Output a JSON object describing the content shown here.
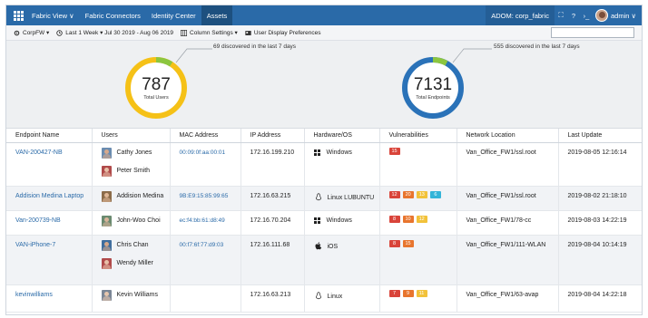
{
  "nav": {
    "items": [
      "Fabric View ∨",
      "Fabric Connectors",
      "Identity Center",
      "Assets"
    ],
    "adom": "ADOM: corp_fabric",
    "user": "admin ∨"
  },
  "toolbar": {
    "device": "CorpFW ▾",
    "time_range": "Last 1 Week ▾ Jul 30 2019 - Aug 06 2019",
    "column_settings": "Column Settings ▾",
    "user_display": "User Display Preferences",
    "search_value": ""
  },
  "summary": {
    "users": {
      "count": "787",
      "label": "Total Users",
      "discovered": "69 discovered in the last 7 days",
      "discovered_fraction": 0.09
    },
    "endpoints": {
      "count": "7131",
      "label": "Total Endpoints",
      "discovered": "555 discovered in the last 7 days",
      "discovered_fraction": 0.08
    }
  },
  "colors": {
    "nav": "#2a6aa8",
    "users_ring": "#f5c117",
    "endpoints_ring": "#2a72b8",
    "discovered_ring": "#8cc63f",
    "link": "#2a6aa8"
  },
  "table": {
    "headers": [
      "Endpoint Name",
      "Users",
      "MAC Address",
      "IP Address",
      "Hardware/OS",
      "Vulnerabilities",
      "Network Location",
      "Last Update"
    ],
    "rows": [
      {
        "endpoint": "VAN-200427-NB",
        "users": [
          "Cathy Jones",
          "Peter Smith"
        ],
        "mac": "00:09:0f:aa:00:01",
        "ip": "172.16.199.210",
        "os_icon": "windows-icon",
        "os": "Windows",
        "vulns": [
          {
            "sev": "critical",
            "count": "15"
          }
        ],
        "location": "Van_Office_FW1/ssl.root",
        "updated": "2019-08-05 12:16:14"
      },
      {
        "endpoint": "Addision Medina Laptop",
        "users": [
          "Addision Medina"
        ],
        "mac": "9B:E9:15:85:99:65",
        "ip": "172.16.63.215",
        "os_icon": "linux-icon",
        "os": "Linux LUBUNTU",
        "vulns": [
          {
            "sev": "critical",
            "count": "12"
          },
          {
            "sev": "high",
            "count": "20"
          },
          {
            "sev": "medium",
            "count": "13"
          },
          {
            "sev": "low",
            "count": "6"
          }
        ],
        "location": "Van_Office_FW1/ssl.root",
        "updated": "2019-08-02 21:18:10"
      },
      {
        "endpoint": "Van-200739-NB",
        "users": [
          "John-Woo Choi"
        ],
        "mac": "ec:f4:bb:61:d8:49",
        "ip": "172.16.70.204",
        "os_icon": "windows-icon",
        "os": "Windows",
        "vulns": [
          {
            "sev": "critical",
            "count": "8"
          },
          {
            "sev": "high",
            "count": "10"
          },
          {
            "sev": "medium",
            "count": "12"
          }
        ],
        "location": "Van_Office_FW1/78-cc",
        "updated": "2019-08-03 14:22:19"
      },
      {
        "endpoint": "VAN-iPhone-7",
        "users": [
          "Chris Chan",
          "Wendy Miller"
        ],
        "mac": "00:f7:6f:77:d9:03",
        "ip": "172.16.111.68",
        "os_icon": "apple-icon",
        "os": "iOS",
        "vulns": [
          {
            "sev": "critical",
            "count": "8"
          },
          {
            "sev": "high",
            "count": "15"
          }
        ],
        "location": "Van_Office_FW1/111-WLAN",
        "updated": "2019-08-04 10:14:19"
      },
      {
        "endpoint": "kevinwilliams",
        "users": [
          "Kevin Williams"
        ],
        "mac": "",
        "ip": "172.16.63.213",
        "os_icon": "linux-icon",
        "os": "Linux",
        "vulns": [
          {
            "sev": "critical",
            "count": "7"
          },
          {
            "sev": "high",
            "count": "9"
          },
          {
            "sev": "medium",
            "count": "11"
          }
        ],
        "location": "Van_Office_FW1/63-avap",
        "updated": "2019-08-04 14:22:18"
      }
    ]
  }
}
